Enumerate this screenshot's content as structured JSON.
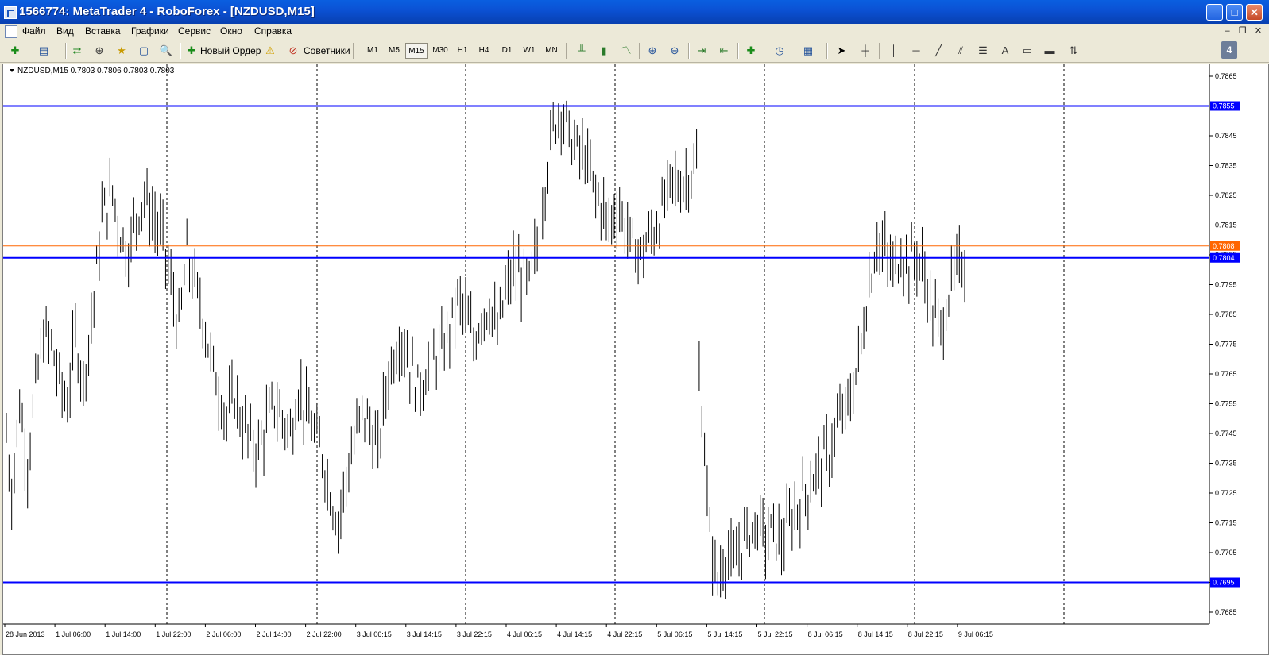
{
  "window": {
    "title": "1566774: MetaTrader 4 - RoboForex - [NZDUSD,M15]",
    "controls": {
      "minimize": "_",
      "maximize": "□",
      "close": "✕"
    }
  },
  "menu": {
    "items": [
      "Файл",
      "Вид",
      "Вставка",
      "Графики",
      "Сервис",
      "Окно",
      "Справка"
    ],
    "mdi": {
      "minimize": "–",
      "restore": "❐",
      "close": "✕"
    }
  },
  "toolbar": {
    "new_order_label": "Новый Ордер",
    "experts_label": "Советники",
    "timeframes": [
      "M1",
      "M5",
      "M15",
      "M30",
      "H1",
      "H4",
      "D1",
      "W1",
      "MN"
    ],
    "active_timeframe": "M15",
    "draw_text_tool": "A",
    "tab_number": "4"
  },
  "chart_data": {
    "type": "bar",
    "header": "NZDUSD,M15  0.7803 0.7806 0.7803 0.7803",
    "symbol": "NZDUSD",
    "timeframe": "M15",
    "ylim": [
      0.7681,
      0.7869
    ],
    "y_ticks": [
      "0.7865",
      "0.7855",
      "0.7845",
      "0.7835",
      "0.7825",
      "0.7815",
      "0.7805",
      "0.7795",
      "0.7785",
      "0.7775",
      "0.7765",
      "0.7755",
      "0.7745",
      "0.7735",
      "0.7725",
      "0.7715",
      "0.7705",
      "0.7695",
      "0.7685"
    ],
    "x_ticks": [
      "28 Jun 2013",
      "1 Jul 06:00",
      "1 Jul 14:00",
      "1 Jul 22:00",
      "2 Jul 06:00",
      "2 Jul 14:00",
      "2 Jul 22:00",
      "3 Jul 06:15",
      "3 Jul 14:15",
      "3 Jul 22:15",
      "4 Jul 06:15",
      "4 Jul 14:15",
      "4 Jul 22:15",
      "5 Jul 06:15",
      "5 Jul 14:15",
      "5 Jul 22:15",
      "8 Jul 06:15",
      "8 Jul 14:15",
      "8 Jul 22:15",
      "9 Jul 06:15"
    ],
    "horizontal_lines": [
      {
        "value": 0.7855,
        "label": "0.7855",
        "color": "#0000ff"
      },
      {
        "value": 0.7804,
        "label": "0.7804",
        "color": "#0000ff"
      },
      {
        "value": 0.7695,
        "label": "0.7695",
        "color": "#0000ff"
      },
      {
        "value": 0.7808,
        "label": "0.7808",
        "color": "#ff6600"
      }
    ],
    "price_path": [
      [
        0,
        0.7745
      ],
      [
        2,
        0.7725
      ],
      [
        5,
        0.7755
      ],
      [
        8,
        0.7735
      ],
      [
        11,
        0.776
      ],
      [
        14,
        0.7778
      ],
      [
        17,
        0.7775
      ],
      [
        20,
        0.7762
      ],
      [
        23,
        0.7755
      ],
      [
        26,
        0.7778
      ],
      [
        29,
        0.7762
      ],
      [
        33,
        0.779
      ],
      [
        36,
        0.7818
      ],
      [
        40,
        0.7826
      ],
      [
        43,
        0.7812
      ],
      [
        46,
        0.7806
      ],
      [
        49,
        0.7818
      ],
      [
        52,
        0.7825
      ],
      [
        55,
        0.7818
      ],
      [
        59,
        0.781
      ],
      [
        62,
        0.7795
      ],
      [
        65,
        0.778
      ],
      [
        68,
        0.7805
      ],
      [
        71,
        0.7795
      ],
      [
        74,
        0.7785
      ],
      [
        77,
        0.777
      ],
      [
        80,
        0.776
      ],
      [
        83,
        0.775
      ],
      [
        86,
        0.7758
      ],
      [
        89,
        0.7748
      ],
      [
        92,
        0.7742
      ],
      [
        95,
        0.774
      ],
      [
        98,
        0.7748
      ],
      [
        101,
        0.7755
      ],
      [
        104,
        0.775
      ],
      [
        107,
        0.7745
      ],
      [
        110,
        0.776
      ],
      [
        113,
        0.7752
      ],
      [
        116,
        0.7745
      ],
      [
        119,
        0.7738
      ],
      [
        122,
        0.7725
      ],
      [
        125,
        0.7715
      ],
      [
        128,
        0.773
      ],
      [
        131,
        0.7742
      ],
      [
        134,
        0.7752
      ],
      [
        137,
        0.7748
      ],
      [
        140,
        0.7738
      ],
      [
        143,
        0.776
      ],
      [
        146,
        0.7772
      ],
      [
        149,
        0.7778
      ],
      [
        152,
        0.7768
      ],
      [
        155,
        0.776
      ],
      [
        158,
        0.7765
      ],
      [
        161,
        0.777
      ],
      [
        164,
        0.7772
      ],
      [
        167,
        0.778
      ],
      [
        170,
        0.779
      ],
      [
        173,
        0.7785
      ],
      [
        176,
        0.7775
      ],
      [
        179,
        0.7785
      ],
      [
        182,
        0.7788
      ],
      [
        185,
        0.7778
      ],
      [
        188,
        0.7792
      ],
      [
        191,
        0.78
      ],
      [
        194,
        0.7798
      ],
      [
        197,
        0.7795
      ],
      [
        200,
        0.7808
      ],
      [
        203,
        0.783
      ],
      [
        206,
        0.7848
      ],
      [
        209,
        0.7855
      ],
      [
        212,
        0.7845
      ],
      [
        215,
        0.784
      ],
      [
        218,
        0.7838
      ],
      [
        221,
        0.7828
      ],
      [
        224,
        0.7822
      ],
      [
        227,
        0.7815
      ],
      [
        230,
        0.7822
      ],
      [
        233,
        0.7815
      ],
      [
        236,
        0.7808
      ],
      [
        239,
        0.7805
      ],
      [
        242,
        0.781
      ],
      [
        245,
        0.7815
      ],
      [
        248,
        0.7822
      ],
      [
        251,
        0.783
      ],
      [
        254,
        0.7828
      ],
      [
        257,
        0.7832
      ],
      [
        260,
        0.7835
      ],
      [
        261,
        0.7765
      ],
      [
        263,
        0.774
      ],
      [
        265,
        0.771
      ],
      [
        268,
        0.7695
      ],
      [
        271,
        0.7705
      ],
      [
        274,
        0.77
      ],
      [
        277,
        0.7708
      ],
      [
        280,
        0.7712
      ],
      [
        283,
        0.7715
      ],
      [
        286,
        0.771
      ],
      [
        289,
        0.7712
      ],
      [
        292,
        0.7708
      ],
      [
        295,
        0.7715
      ],
      [
        298,
        0.772
      ],
      [
        301,
        0.7725
      ],
      [
        304,
        0.773
      ],
      [
        307,
        0.7735
      ],
      [
        310,
        0.7738
      ],
      [
        313,
        0.7748
      ],
      [
        316,
        0.7752
      ],
      [
        319,
        0.776
      ],
      [
        322,
        0.7775
      ],
      [
        325,
        0.7795
      ],
      [
        328,
        0.781
      ],
      [
        331,
        0.7805
      ],
      [
        334,
        0.78
      ],
      [
        337,
        0.7806
      ],
      [
        340,
        0.7802
      ],
      [
        343,
        0.7805
      ],
      [
        346,
        0.7798
      ],
      [
        349,
        0.7785
      ],
      [
        352,
        0.778
      ],
      [
        355,
        0.7792
      ],
      [
        358,
        0.78
      ],
      [
        361,
        0.7803
      ]
    ],
    "total_bars": 362,
    "vertical_gridlines_at_ticks": [
      3,
      6,
      9,
      12,
      15,
      18
    ]
  }
}
